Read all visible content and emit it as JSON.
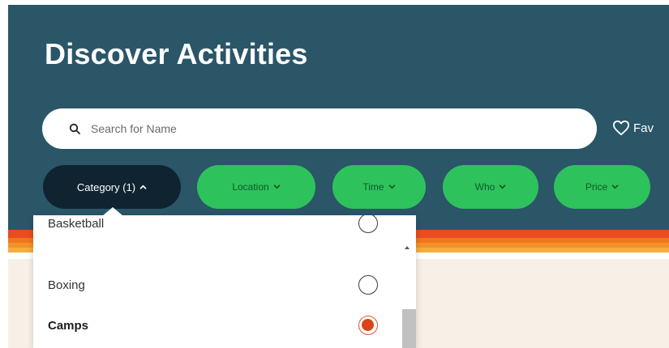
{
  "page": {
    "title": "Discover Activities"
  },
  "search": {
    "placeholder": "Search for Name",
    "icon": "search-icon"
  },
  "favorites": {
    "label": "Fav",
    "icon": "heart-outline-icon"
  },
  "filters": [
    {
      "label": "Category (1)",
      "icon": "chevron-up-icon",
      "active": true
    },
    {
      "label": "Location",
      "icon": "chevron-down-icon",
      "active": false
    },
    {
      "label": "Time",
      "icon": "chevron-down-icon",
      "active": false
    },
    {
      "label": "Who",
      "icon": "chevron-down-icon",
      "active": false
    },
    {
      "label": "Price",
      "icon": "chevron-down-icon",
      "active": false
    }
  ],
  "category_dropdown": {
    "options": [
      {
        "label": "Basketball",
        "checked": false
      },
      {
        "label": "Boxing",
        "checked": false
      },
      {
        "label": "Camps",
        "checked": true
      }
    ]
  },
  "colors": {
    "header_bg": "#2a5668",
    "chip_green": "#2ec25c",
    "chip_active": "#0f2430",
    "radio_selected": "#d9441b",
    "stripe_red": "#ea4c1f",
    "stripe_orange": "#f0771d"
  }
}
